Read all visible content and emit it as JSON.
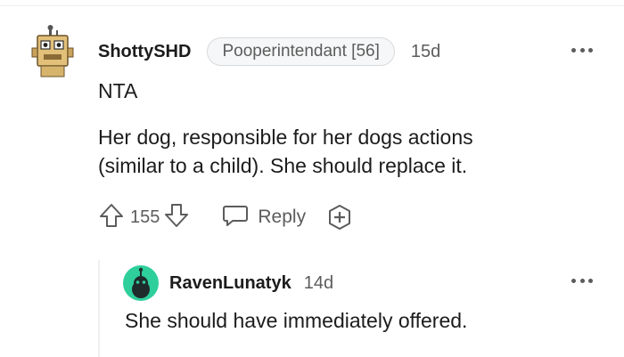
{
  "comment": {
    "username": "ShottySHD",
    "flair": "Pooperintendant [56]",
    "age": "15d",
    "lines": [
      "NTA",
      "Her dog, responsible for her dogs actions",
      "(similar to a child). She should replace it."
    ],
    "votes": "155",
    "reply_label": "Reply"
  },
  "reply": {
    "username": "RavenLunatyk",
    "age": "14d",
    "text": "She should have immediately offered."
  },
  "colors": {
    "text": "#1c1c1c",
    "meta": "#5c5c5c",
    "avatar_reply": "#2ecf9b"
  },
  "icons": [
    "upvote-icon",
    "downvote-icon",
    "reply-icon",
    "award-icon",
    "more-options-icon"
  ]
}
